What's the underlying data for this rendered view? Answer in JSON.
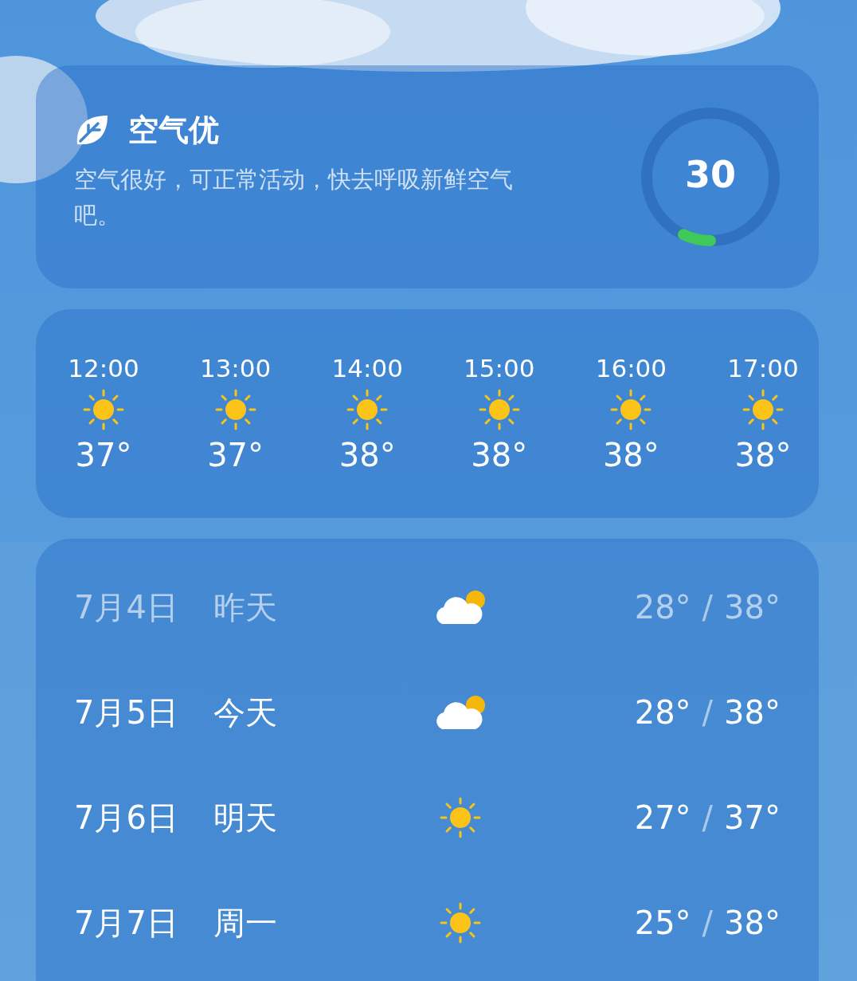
{
  "air_quality": {
    "title": "空气优",
    "description": "空气很好，可正常活动，快去呼吸新鲜空气吧。",
    "index": "30",
    "level": 0.07
  },
  "hourly": [
    {
      "time": "12:00",
      "kind": "sun",
      "temp": "37°"
    },
    {
      "time": "13:00",
      "kind": "sun",
      "temp": "37°"
    },
    {
      "time": "14:00",
      "kind": "sun",
      "temp": "38°"
    },
    {
      "time": "15:00",
      "kind": "sun",
      "temp": "38°"
    },
    {
      "time": "16:00",
      "kind": "sun",
      "temp": "38°"
    },
    {
      "time": "17:00",
      "kind": "sun",
      "temp": "38°"
    }
  ],
  "daily": [
    {
      "date": "7月4日",
      "day": "昨天",
      "kind": "cloud_sun",
      "low": "28°",
      "separator": "/",
      "high": "38°",
      "past": true
    },
    {
      "date": "7月5日",
      "day": "今天",
      "kind": "cloud_sun",
      "low": "28°",
      "separator": "/",
      "high": "38°",
      "past": false
    },
    {
      "date": "7月6日",
      "day": "明天",
      "kind": "sun",
      "low": "27°",
      "separator": "/",
      "high": "37°",
      "past": false
    },
    {
      "date": "7月7日",
      "day": "周一",
      "kind": "sun",
      "low": "25°",
      "separator": "/",
      "high": "38°",
      "past": false
    }
  ]
}
